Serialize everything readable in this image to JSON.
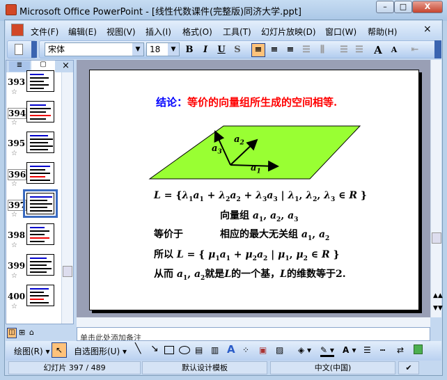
{
  "window": {
    "title": "Microsoft Office PowerPoint - [线性代数课件(完整版)同济大学.ppt]",
    "minimize": "–",
    "maximize": "□",
    "close": "X"
  },
  "menu": {
    "items": [
      "文件(F)",
      "编辑(E)",
      "视图(V)",
      "插入(I)",
      "格式(O)",
      "工具(T)",
      "幻灯片放映(D)",
      "窗口(W)",
      "帮助(H)"
    ],
    "close": "×"
  },
  "toolbar": {
    "font": "宋体",
    "size": "18",
    "bold": "B",
    "italic": "I",
    "underline": "U",
    "shadow": "S",
    "grow": "A",
    "shrink": "A"
  },
  "pane": {
    "close": "×",
    "slides": [
      {
        "num": "393"
      },
      {
        "num": "394"
      },
      {
        "num": "395"
      },
      {
        "num": "396"
      },
      {
        "num": "397",
        "selected": true
      },
      {
        "num": "398"
      },
      {
        "num": "399"
      },
      {
        "num": "400"
      }
    ]
  },
  "slide": {
    "title_label": "结论：",
    "title_text": "等价的向量组所生成的空间相等.",
    "fill_color": "#99ff33",
    "label_a1": "a",
    "label_a2": "a",
    "label_a3": "a",
    "s1": "1",
    "s2": "2",
    "s3": "3",
    "line1": {
      "a": "L = {",
      "b": "λ",
      "c": "a",
      "d": " + ",
      "e": "| ",
      "f": ", ",
      "g": " ∈ R }"
    },
    "line2_prefix": "向量组 ",
    "line3_left": "等价于",
    "line3_right": "相应的最大无关组 ",
    "line4_prefix": "所以 ",
    "line4_L": "L = { ",
    "mu": "μ",
    "R": " ∈ R }",
    "line5_prefix": "从而 ",
    "line5_mid": "就是",
    "line5_L": "L",
    "line5_mid2": "的一个基，",
    "line5_end": "的维数等于2."
  },
  "notes": {
    "placeholder": "单击此处添加备注"
  },
  "drawing": {
    "draw": "绘图(R)",
    "autoshapes": "自选图形(U)"
  },
  "status": {
    "slide": "幻灯片 397 / 489",
    "template": "默认设计模板",
    "language": "中文(中国)"
  }
}
